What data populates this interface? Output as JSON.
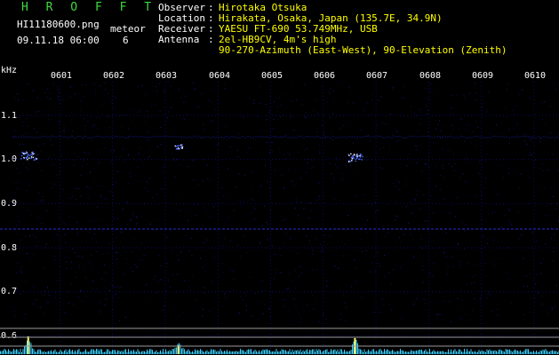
{
  "header": {
    "app_title": "H R O F F T",
    "filename": "HI11180600.png",
    "datetime": "09.11.18 06:00",
    "meteor_label": "meteor",
    "meteor_count": "6",
    "fields": [
      {
        "label": "Observer",
        "value": "Hirotaka Otsuka"
      },
      {
        "label": "Location",
        "value": "Hirakata, Osaka, Japan (135.7E, 34.9N)"
      },
      {
        "label": "Receiver",
        "value": "YAESU FT-690 53.749MHz, USB"
      },
      {
        "label": "Antenna",
        "value": "2el-HB9CV, 4m's high"
      }
    ],
    "antenna_line2": "90-270-Azimuth (East-West), 90-Elevation (Zenith)"
  },
  "axis": {
    "unit": "kHz",
    "freq_ticks": [
      "1.1",
      "1.0",
      "0.9",
      "0.8",
      "0.7",
      "0.6"
    ],
    "time_ticks": [
      "0601",
      "0602",
      "0603",
      "0604",
      "0605",
      "0606",
      "0607",
      "0608",
      "0609",
      "0610"
    ]
  },
  "colors": {
    "background": "#000000",
    "header_text": "#ffffff",
    "value_text": "#ffff00",
    "title_text": "#3cdc3c",
    "grid": "#0a0a6a",
    "noise": "#1a1aa0",
    "echo": "#4a6cff",
    "spectrum": "#3ad0ff",
    "marker_lines": "#9a9a9a"
  },
  "echoes": [
    {
      "time_min": 0.4,
      "freq_khz": 1.01,
      "strength": 1.0
    },
    {
      "time_min": 3.25,
      "freq_khz": 1.03,
      "strength": 0.5
    },
    {
      "time_min": 6.6,
      "freq_khz": 1.005,
      "strength": 0.9
    }
  ]
}
